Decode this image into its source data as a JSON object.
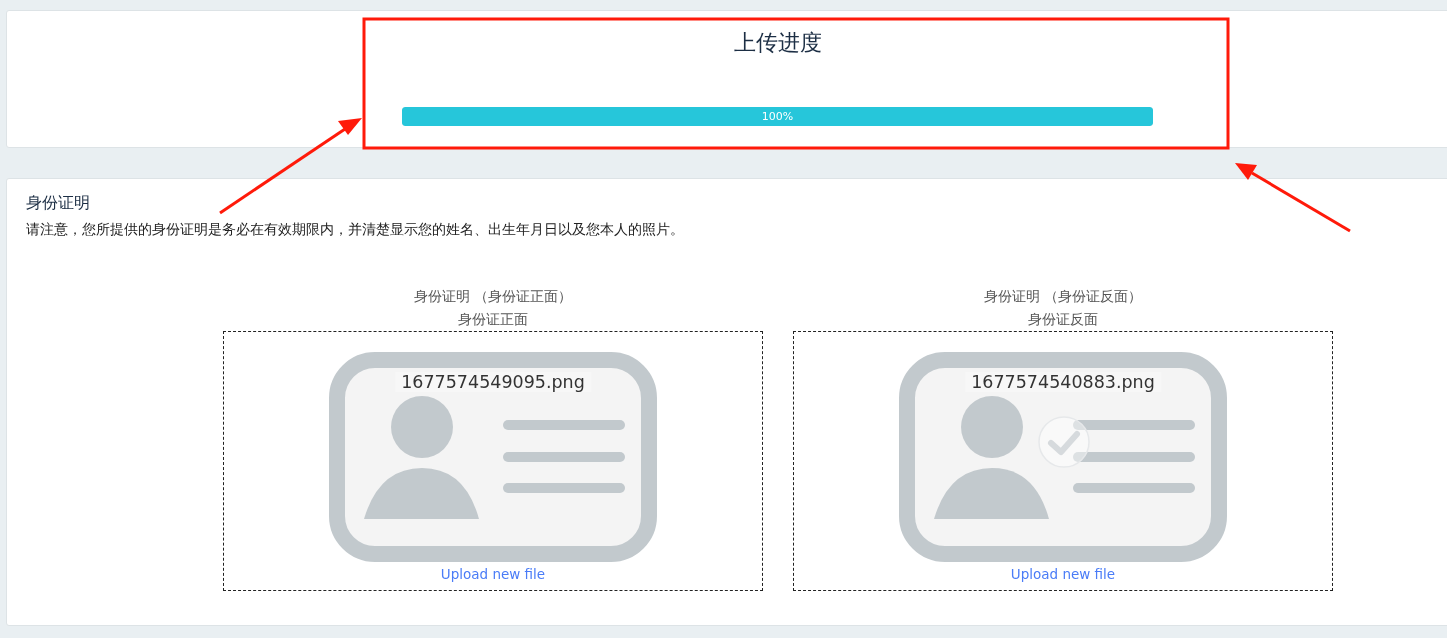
{
  "progress": {
    "title": "上传进度",
    "level": 1.0,
    "label": "100%"
  },
  "identity": {
    "title": "身份证明",
    "notice": "请注意，您所提供的身份证明是务必在有效期限内，并清楚显示您的姓名、出生年月日以及您本人的照片。",
    "uploads": [
      {
        "heading": "身份证明 （身份证正面）",
        "subheading": "身份证正面",
        "file_name": "1677574549095.png",
        "checked": false,
        "link": "Upload new file"
      },
      {
        "heading": "身份证明 （身份证反面）",
        "subheading": "身份证反面",
        "file_name": "1677574540883.png",
        "checked": true,
        "link": "Upload new file"
      }
    ]
  }
}
